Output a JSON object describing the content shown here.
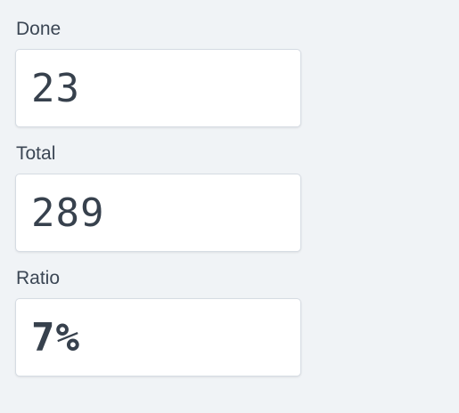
{
  "fields": {
    "done": {
      "label": "Done",
      "value": "23"
    },
    "total": {
      "label": "Total",
      "value": "289"
    },
    "ratio": {
      "label": "Ratio",
      "value": "7%"
    }
  }
}
